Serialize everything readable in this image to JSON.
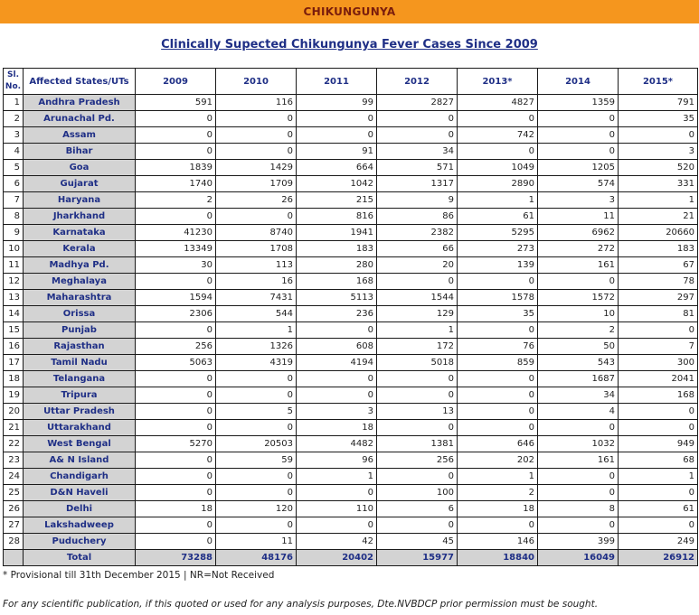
{
  "header": {
    "banner": "CHIKUNGUNYA"
  },
  "title": "Clinically Supected Chikungunya Fever Cases Since 2009",
  "table": {
    "columns": [
      "Sl. No.",
      "Affected States/UTs",
      "2009",
      "2010",
      "2011",
      "2012",
      "2013*",
      "2014",
      "2015*"
    ],
    "rows": [
      [
        "1",
        "Andhra Pradesh",
        "591",
        "116",
        "99",
        "2827",
        "4827",
        "1359",
        "791"
      ],
      [
        "2",
        "Arunachal Pd.",
        "0",
        "0",
        "0",
        "0",
        "0",
        "0",
        "35"
      ],
      [
        "3",
        "Assam",
        "0",
        "0",
        "0",
        "0",
        "742",
        "0",
        "0"
      ],
      [
        "4",
        "Bihar",
        "0",
        "0",
        "91",
        "34",
        "0",
        "0",
        "3"
      ],
      [
        "5",
        "Goa",
        "1839",
        "1429",
        "664",
        "571",
        "1049",
        "1205",
        "520"
      ],
      [
        "6",
        "Gujarat",
        "1740",
        "1709",
        "1042",
        "1317",
        "2890",
        "574",
        "331"
      ],
      [
        "7",
        "Haryana",
        "2",
        "26",
        "215",
        "9",
        "1",
        "3",
        "1"
      ],
      [
        "8",
        "Jharkhand",
        "0",
        "0",
        "816",
        "86",
        "61",
        "11",
        "21"
      ],
      [
        "9",
        "Karnataka",
        "41230",
        "8740",
        "1941",
        "2382",
        "5295",
        "6962",
        "20660"
      ],
      [
        "10",
        "Kerala",
        "13349",
        "1708",
        "183",
        "66",
        "273",
        "272",
        "183"
      ],
      [
        "11",
        "Madhya Pd.",
        "30",
        "113",
        "280",
        "20",
        "139",
        "161",
        "67"
      ],
      [
        "12",
        "Meghalaya",
        "0",
        "16",
        "168",
        "0",
        "0",
        "0",
        "78"
      ],
      [
        "13",
        "Maharashtra",
        "1594",
        "7431",
        "5113",
        "1544",
        "1578",
        "1572",
        "297"
      ],
      [
        "14",
        "Orissa",
        "2306",
        "544",
        "236",
        "129",
        "35",
        "10",
        "81"
      ],
      [
        "15",
        "Punjab",
        "0",
        "1",
        "0",
        "1",
        "0",
        "2",
        "0"
      ],
      [
        "16",
        "Rajasthan",
        "256",
        "1326",
        "608",
        "172",
        "76",
        "50",
        "7"
      ],
      [
        "17",
        "Tamil Nadu",
        "5063",
        "4319",
        "4194",
        "5018",
        "859",
        "543",
        "300"
      ],
      [
        "18",
        "Telangana",
        "0",
        "0",
        "0",
        "0",
        "0",
        "1687",
        "2041"
      ],
      [
        "19",
        "Tripura",
        "0",
        "0",
        "0",
        "0",
        "0",
        "34",
        "168"
      ],
      [
        "20",
        "Uttar Pradesh",
        "0",
        "5",
        "3",
        "13",
        "0",
        "4",
        "0"
      ],
      [
        "21",
        "Uttarakhand",
        "0",
        "0",
        "18",
        "0",
        "0",
        "0",
        "0"
      ],
      [
        "22",
        "West Bengal",
        "5270",
        "20503",
        "4482",
        "1381",
        "646",
        "1032",
        "949"
      ],
      [
        "23",
        "A& N Island",
        "0",
        "59",
        "96",
        "256",
        "202",
        "161",
        "68"
      ],
      [
        "24",
        "Chandigarh",
        "0",
        "0",
        "1",
        "0",
        "1",
        "0",
        "1"
      ],
      [
        "25",
        "D&N Haveli",
        "0",
        "0",
        "0",
        "100",
        "2",
        "0",
        "0"
      ],
      [
        "26",
        "Delhi",
        "18",
        "120",
        "110",
        "6",
        "18",
        "8",
        "61"
      ],
      [
        "27",
        "Lakshadweep",
        "0",
        "0",
        "0",
        "0",
        "0",
        "0",
        "0"
      ],
      [
        "28",
        "Puduchery",
        "0",
        "11",
        "42",
        "45",
        "146",
        "399",
        "249"
      ]
    ],
    "total": [
      "",
      "Total",
      "73288",
      "48176",
      "20402",
      "15977",
      "18840",
      "16049",
      "26912"
    ]
  },
  "footnote": "* Provisional till 31th December 2015 | NR=Not Received",
  "disclaimer": "For any scientific publication, if this quoted or used for any analysis purposes, Dte.NVBDCP prior permission must be sought."
}
